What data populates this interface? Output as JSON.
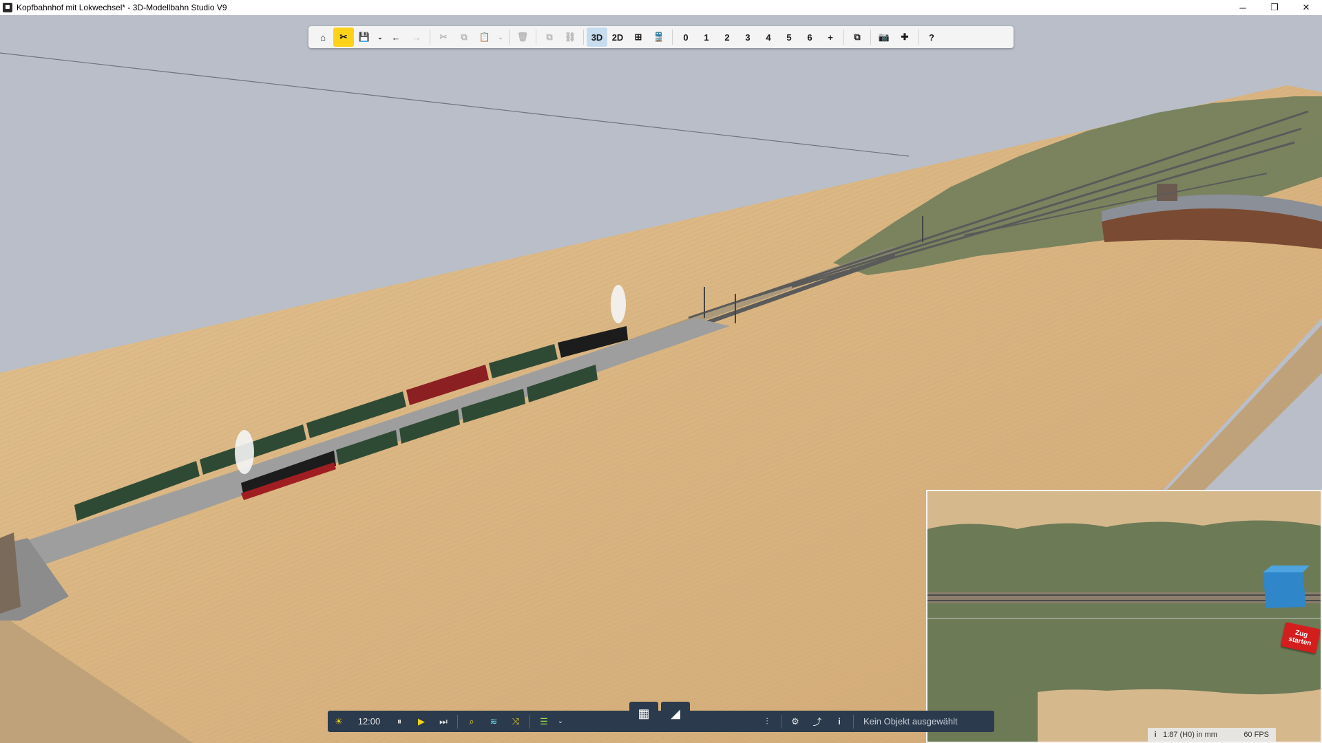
{
  "window": {
    "title": "Kopfbahnhof mit Lokwechsel* - 3D-Modellbahn Studio V9",
    "minimize": "─",
    "restore": "❐",
    "close": "✕"
  },
  "toolbar": {
    "home": "⌂",
    "tools": "✂",
    "save": "💾",
    "save_dropdown": "⌄",
    "undo": "←",
    "redo": "→",
    "cut": "✂",
    "copy": "⧉",
    "paste": "📋",
    "paste_dropdown": "⌄",
    "delete": "🗑",
    "duplicate": "⧉",
    "link": "⛓",
    "view_3d": "3D",
    "view_2d": "2D",
    "grid": "⊞",
    "train_view": "🚆",
    "layers": [
      "0",
      "1",
      "2",
      "3",
      "4",
      "5",
      "6"
    ],
    "add": "+",
    "windows": "⧉",
    "camera": "📷",
    "plugins": "✚",
    "help": "?"
  },
  "bottombar": {
    "sun": "☀",
    "time": "12:00",
    "pause": "⏸",
    "play": "▶",
    "step": "⏭",
    "search": "⌕",
    "layers": "≋",
    "shuffle": "⤨",
    "list": "☰",
    "list_dropdown": "⌄",
    "grid_view": "▦",
    "terrain": "◢",
    "sliders": "⫶",
    "settings": "⚙",
    "tracks": "⤴",
    "info": "i",
    "status_text": "Kein Objekt ausgewählt"
  },
  "minimap": {
    "button_text": "Zug starten"
  },
  "scale": {
    "info": "i",
    "scale_text": "1:87 (H0) in mm",
    "fps": "60 FPS"
  },
  "colors": {
    "sky": "#b9bec8",
    "table": "#ddb888",
    "grass": "#6f7d5a",
    "toolbar_active": "#ffd21a",
    "bottombar": "#2b3a4c",
    "start_button": "#d41e1e"
  }
}
